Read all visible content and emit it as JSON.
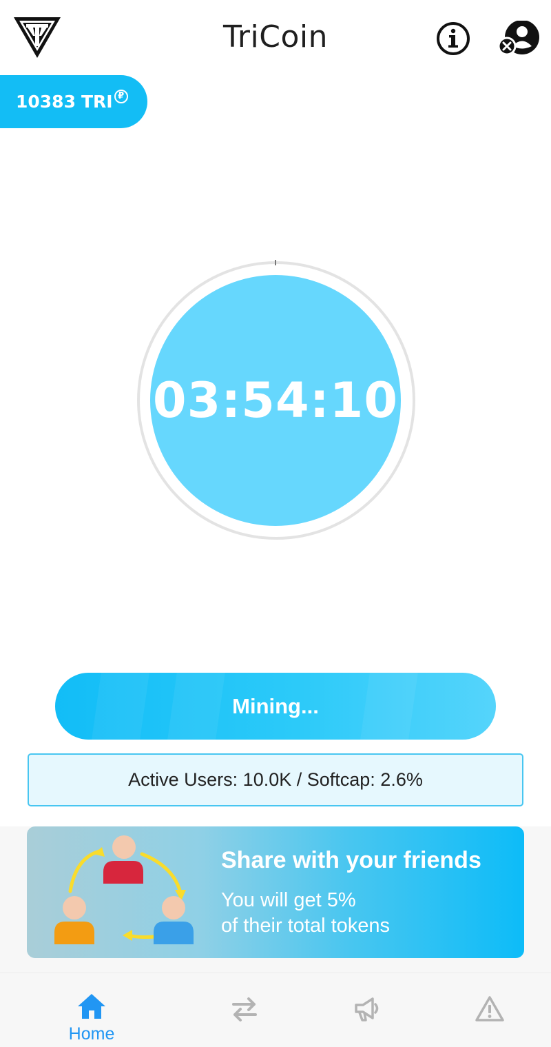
{
  "header": {
    "title": "TriCoin"
  },
  "balance": {
    "amount": "10383",
    "unit": "TRI",
    "symbol": "₽"
  },
  "timer": {
    "value": "03:54:10"
  },
  "mining": {
    "label": "Mining..."
  },
  "stats": {
    "text": "Active Users: 10.0K / Softcap: 2.6%"
  },
  "share": {
    "title": "Share with your friends",
    "line1": "You will get 5%",
    "line2": "of their total tokens"
  },
  "nav": {
    "items": [
      {
        "label": "Home",
        "icon": "home-icon",
        "active": true
      },
      {
        "label": "",
        "icon": "transfer-icon",
        "active": false
      },
      {
        "label": "",
        "icon": "megaphone-icon",
        "active": false
      },
      {
        "label": "",
        "icon": "warning-icon",
        "active": false
      }
    ]
  },
  "colors": {
    "primary": "#13bdf5",
    "timer_fill": "#66d7fd",
    "nav_active": "#2196f3",
    "nav_inactive": "#b3b3b3"
  }
}
